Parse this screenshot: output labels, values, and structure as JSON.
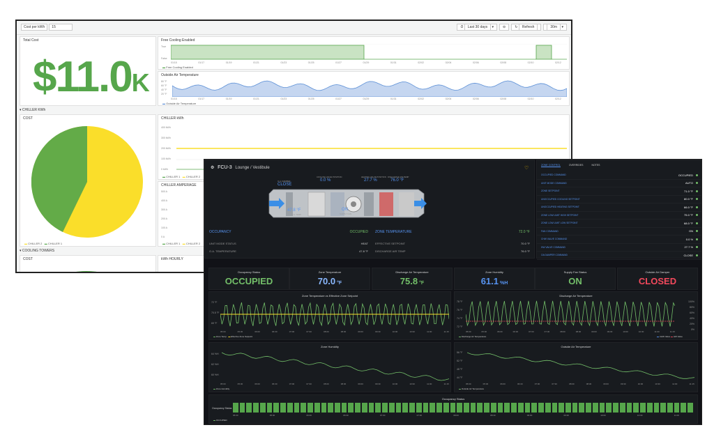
{
  "light": {
    "var_label": "Cost per kWh",
    "var_value": "15",
    "time_range": "Last 30 days",
    "refresh": "Refresh",
    "refresh_interval": "30m",
    "total_cost_title": "Total Cost",
    "total_cost_value": "$11.0",
    "total_cost_unit": "K",
    "free_cooling_title": "Free Cooling Enabled",
    "free_cooling_yticks": [
      "True",
      "False"
    ],
    "free_cooling_legend": "Free Cooling Enabled",
    "oat_title": "Outside Air Temperature",
    "oat_yticks": [
      "80 °F",
      "60 °F",
      "40 °F",
      "20 °F"
    ],
    "oat_legend": "Outside Air Temperature",
    "date_ticks": [
      "01/15",
      "01/17",
      "01/19",
      "01/21",
      "01/23",
      "01/25",
      "01/27",
      "01/29",
      "01/31",
      "02/02",
      "02/04",
      "02/06",
      "02/08",
      "02/10",
      "02/12"
    ],
    "chiller_row": "CHILLER KWh",
    "cost_title": "COST",
    "chiller_kwh_title": "CHILLER kWh",
    "chiller_kwh_yticks": [
      "400 kWh",
      "300 kWh",
      "200 kWh",
      "100 kWh",
      "0 kWh"
    ],
    "chiller_legend": [
      "CHILLER 1",
      "CHILLER 2"
    ],
    "pie_legend": [
      "CHILLER 2",
      "CHILLER 1"
    ],
    "amperage_title": "CHILLER AMPERAGE",
    "amperage_yticks": [
      "500 A",
      "400 A",
      "300 A",
      "200 A",
      "100 A",
      "0 A"
    ],
    "cooling_row": "COOLING TOWERS",
    "cost2_title": "COST",
    "kwh_hourly_title": "kWh HOURLY",
    "colors": {
      "green": "#56a64b",
      "yellow": "#fade2a"
    }
  },
  "dark": {
    "unit_title": "FCU-3",
    "unit_location": "Lounge / Vestibule",
    "tabs": [
      "ZONE CONTROL",
      "OVERRIDES",
      "NOTES"
    ],
    "diagram": {
      "oa_damper_label": "O.A. DAMPER",
      "oa_damper_value": "CLOSE",
      "cooling_valve_label": "COOLING VALVE POSITION",
      "cooling_valve_value": "0.0 %",
      "heating_valve_label": "HEATING VALVE POSITION",
      "heating_valve_value": "27.7 %",
      "discharge_label": "DISCHARGE AIR TEMP",
      "discharge_value": "76.0 °F",
      "oa_temp_value": "47.8 °F",
      "oa_temp_label": "O.A. TEMP",
      "fan_value": "ON",
      "fan_label": "SUPPLY FAN"
    },
    "occupancy_label": "OCCUPANCY",
    "occupancy_value": "OCCUPIED",
    "zone_temp_label": "ZONE TEMPERATURE",
    "zone_temp_value": "72.0 °F",
    "unit_mode_label": "UNIT MODE STATUS",
    "unit_mode_value": "HEAT",
    "oa_temp_row_label": "O.A. TEMPERATURE",
    "oa_temp_row_value": "47.8 °F",
    "eff_setpoint_label": "EFFECTIVE SETPOINT",
    "eff_setpoint_value": "70.0 °F",
    "dat_row_label": "DISCHARGE AIR TEMP",
    "dat_row_value": "76.0 °F",
    "settings": [
      {
        "label": "OCCUPIED COMMAND",
        "value": "OCCUPIED"
      },
      {
        "label": "UNIT MODE COMMAND",
        "value": "AUTO"
      },
      {
        "label": "ZONE SETPOINT",
        "value": "71.0 °F"
      },
      {
        "label": "UNOCCUPIED COOLING SETPOINT",
        "value": "80.0 °F"
      },
      {
        "label": "UNOCCUPIED HEATING SETPOINT",
        "value": "66.0 °F"
      },
      {
        "label": "ZONE LOW LIMIT HIGH SETPOINT",
        "value": "75.0 °F"
      },
      {
        "label": "ZONE LOW LIMIT LOW SETPOINT",
        "value": "68.0 °F"
      },
      {
        "label": "FAN COMMAND",
        "value": "ON"
      },
      {
        "label": "CHW VALVE COMMAND",
        "value": "0.0 %"
      },
      {
        "label": "HW VALVE COMMAND",
        "value": "27.7 %"
      },
      {
        "label": "OA DAMPER COMMAND",
        "value": "CLOSE"
      }
    ],
    "stats": [
      {
        "title": "Occupancy Status",
        "value": "OCCUPIED",
        "unit": "",
        "color": "#73bf69"
      },
      {
        "title": "Zone Temperature",
        "value": "70.0",
        "unit": "°F",
        "color": "#8ab8ff"
      },
      {
        "title": "Discharge Air Temperature",
        "value": "75.8",
        "unit": "°F",
        "color": "#73bf69"
      },
      {
        "title": "Zone Humidity",
        "value": "61.1",
        "unit": "%H",
        "color": "#5794f2"
      },
      {
        "title": "Supply Fan Status",
        "value": "ON",
        "unit": "",
        "color": "#73bf69"
      },
      {
        "title": "Outside Air Damper",
        "value": "CLOSED",
        "unit": "",
        "color": "#f2495c"
      }
    ],
    "chart1_title": "Zone Temperature vs Effective Zone Setpoint",
    "chart1_yticks": [
      "72 °F",
      "70.5 °F",
      "69 °F"
    ],
    "chart1_legend": [
      "Zone Temp",
      "Effective Zone Setpoint"
    ],
    "chart2_title": "Discharge Air Temperature",
    "chart2_yticks": [
      "78 °F",
      "76 °F",
      "74 °F",
      "72 °F"
    ],
    "chart2_rticks": [
      "100%",
      "80%",
      "60%",
      "40%",
      "20%",
      "0%"
    ],
    "chart2_legend": [
      "Discharge Air Temperature",
      "CHW Valve",
      "HW Valve"
    ],
    "chart3_title": "Zone Humidity",
    "chart3_yticks": [
      "64 %H",
      "62 %H",
      "60 %H"
    ],
    "chart3_legend": [
      "Zone Humidity"
    ],
    "chart4_title": "Outside Air Temperature",
    "chart4_yticks": [
      "56 °F",
      "52 °F",
      "48 °F",
      "44 °F"
    ],
    "chart4_legend": [
      "Outside Air Temperature"
    ],
    "time_ticks": [
      "05:00",
      "05:30",
      "06:00",
      "06:30",
      "07:00",
      "07:30",
      "08:00",
      "08:30",
      "09:00",
      "09:30",
      "10:00",
      "10:30",
      "11:00",
      "11:15"
    ],
    "occ_title": "Occupancy Status",
    "occ_row_label": "Occupancy Status",
    "occ_legend": "OCCUPIED",
    "occ_ticks": [
      "05:00",
      "05:30",
      "06:00",
      "06:30",
      "07:00",
      "07:30",
      "08:00",
      "08:30",
      "09:00",
      "09:30",
      "10:00",
      "10:30",
      "11:00"
    ]
  }
}
